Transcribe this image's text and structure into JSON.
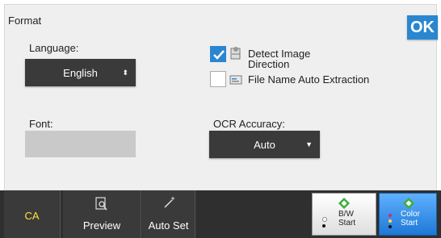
{
  "header": {
    "title": "Format",
    "ok_label": "OK"
  },
  "language": {
    "label": "Language:",
    "value": "English"
  },
  "font": {
    "label": "Font:",
    "value": ""
  },
  "options": [
    {
      "label": "Detect Image Direction",
      "checked": true
    },
    {
      "label": "File Name Auto Extraction",
      "checked": false
    }
  ],
  "ocr_accuracy": {
    "label": "OCR Accuracy:",
    "value": "Auto"
  },
  "bottom_bar": {
    "ca_label": "CA",
    "preview_label": "Preview",
    "auto_set_label": "Auto Set",
    "bw_start_label": "B/W\nStart",
    "color_start_label": "Color\nStart"
  },
  "colors": {
    "accent": "#2a86d0",
    "ca_text": "#ffe23a",
    "dark_button": "#3a3a3a"
  }
}
